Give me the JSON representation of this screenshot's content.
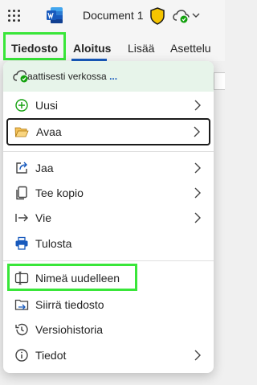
{
  "header": {
    "document_title": "Document 1",
    "app_icon": "word-logo-icon",
    "shield_icon": "shield-icon",
    "sync_icon": "cloud-sync-icon"
  },
  "ribbon": {
    "tabs": [
      {
        "label": "Tiedosto",
        "active": true
      },
      {
        "label": "Aloitus",
        "active": true
      },
      {
        "label": "Lisää",
        "active": false
      },
      {
        "label": "Asettelu",
        "active": false
      }
    ]
  },
  "menu": {
    "status_text": "aattisesti verkossa",
    "status_more": "...",
    "items": [
      {
        "label": "Uusi",
        "icon": "plus-circle-icon",
        "has_submenu": true
      },
      {
        "label": "Avaa",
        "icon": "folder-open-icon",
        "has_submenu": true
      },
      {
        "label": "Jaa",
        "icon": "share-icon",
        "has_submenu": true
      },
      {
        "label": "Tee kopio",
        "icon": "copy-icon",
        "has_submenu": true
      },
      {
        "label": "Vie",
        "icon": "export-icon",
        "has_submenu": true
      },
      {
        "label": "Tulosta",
        "icon": "printer-icon",
        "has_submenu": false
      },
      {
        "label": "Nimeä uudelleen",
        "icon": "rename-icon",
        "has_submenu": false
      },
      {
        "label": "Siirrä tiedosto",
        "icon": "move-folder-icon",
        "has_submenu": false
      },
      {
        "label": "Versiohistoria",
        "icon": "history-icon",
        "has_submenu": false
      },
      {
        "label": "Tiedot",
        "icon": "info-icon",
        "has_submenu": true
      }
    ]
  },
  "colors": {
    "accent": "#185abd",
    "highlight": "#39e639",
    "status_bg": "#e7f4ea",
    "ok_green": "#13a10e"
  }
}
